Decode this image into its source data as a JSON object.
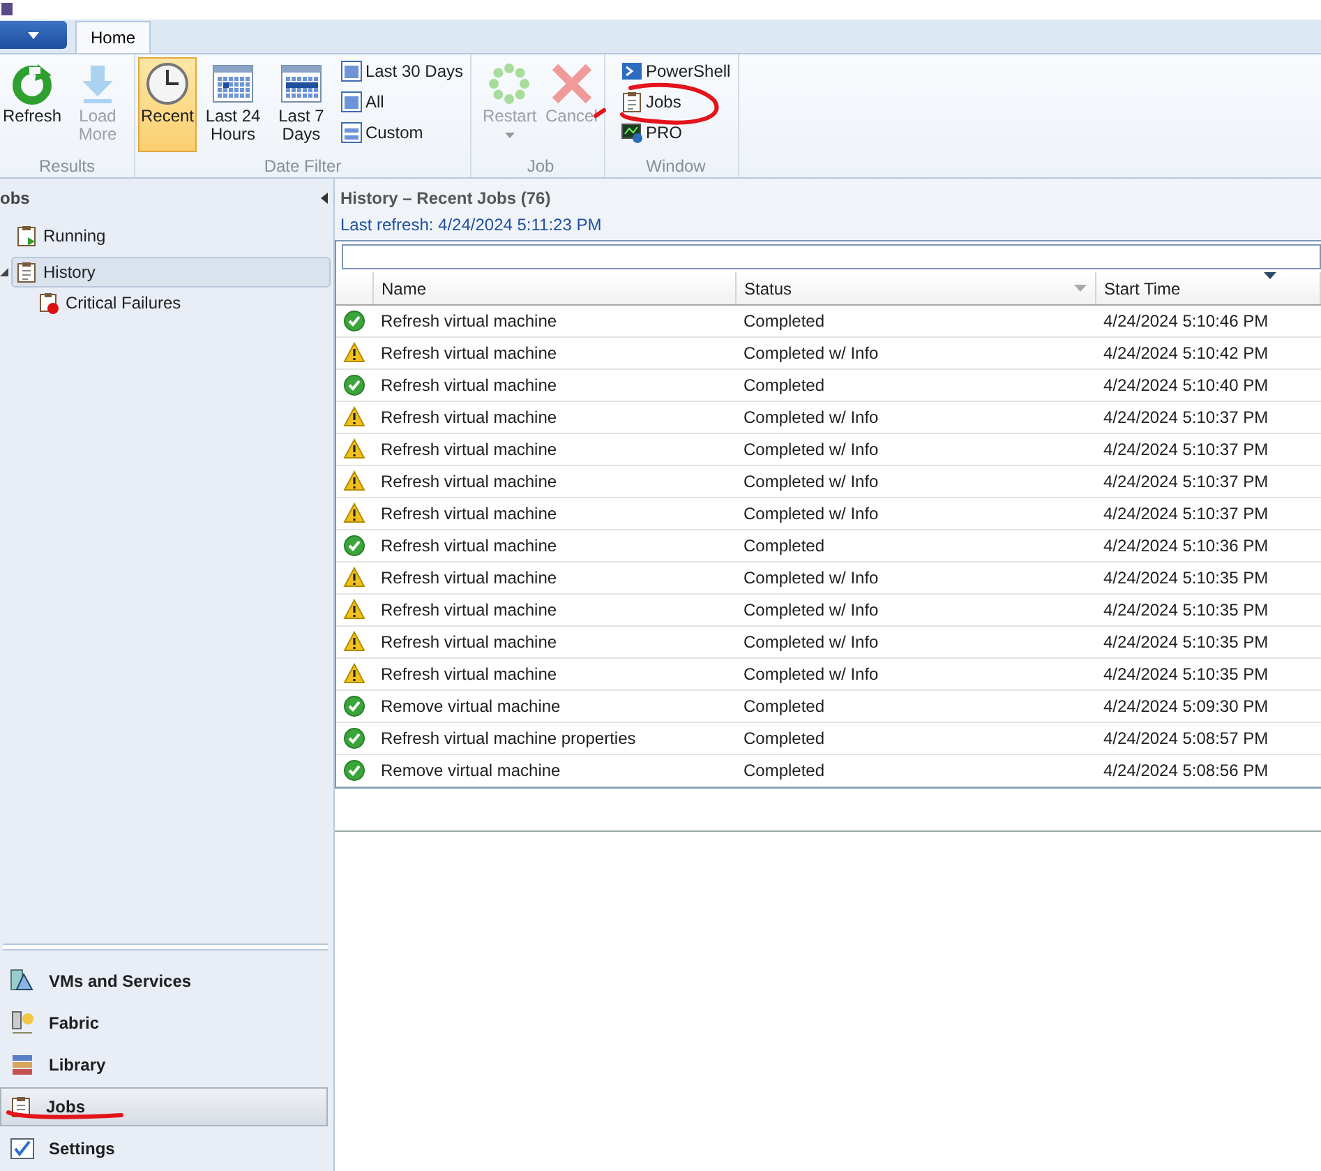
{
  "ribbon": {
    "tabs": [
      {
        "label": "Home",
        "selected": true
      }
    ],
    "groups": [
      {
        "label": "Results",
        "items": [
          {
            "kind": "large",
            "label": "Refresh",
            "selected": false,
            "disabled": false
          },
          {
            "kind": "large",
            "label": "Load More",
            "selected": false,
            "disabled": true
          }
        ]
      },
      {
        "label": "Date Filter",
        "items": [
          {
            "kind": "large",
            "label": "Recent",
            "selected": true,
            "disabled": false
          },
          {
            "kind": "large",
            "label": "Last 24 Hours",
            "selected": false,
            "disabled": false
          },
          {
            "kind": "large",
            "label": "Last 7 Days",
            "selected": false,
            "disabled": false
          },
          {
            "kind": "small",
            "label": "Last 30 Days",
            "selected": false,
            "disabled": false
          },
          {
            "kind": "small",
            "label": "All",
            "selected": false,
            "disabled": false
          },
          {
            "kind": "small",
            "label": "Custom",
            "selected": false,
            "disabled": false
          }
        ]
      },
      {
        "label": "Job",
        "items": [
          {
            "kind": "dropdown",
            "label": "Restart",
            "selected": false,
            "disabled": true
          },
          {
            "kind": "large",
            "label": "Cancel",
            "selected": false,
            "disabled": true
          }
        ]
      },
      {
        "label": "Window",
        "items": [
          {
            "kind": "small",
            "label": "PowerShell",
            "selected": false,
            "disabled": false
          },
          {
            "kind": "small",
            "label": "Jobs",
            "selected": false,
            "disabled": false
          },
          {
            "kind": "small",
            "label": "PRO",
            "selected": false,
            "disabled": false
          }
        ]
      }
    ]
  },
  "sidebar": {
    "title": "obs",
    "tree": [
      {
        "label": "Running",
        "selected": false
      },
      {
        "label": "History",
        "selected": true,
        "expanded": true,
        "children": [
          {
            "label": "Critical Failures",
            "selected": false
          }
        ]
      }
    ],
    "nav": [
      {
        "label": "VMs and Services",
        "selected": false
      },
      {
        "label": "Fabric",
        "selected": false
      },
      {
        "label": "Library",
        "selected": false
      },
      {
        "label": "Jobs",
        "selected": true
      },
      {
        "label": "Settings",
        "selected": false
      }
    ]
  },
  "content": {
    "title": "History – Recent Jobs (76)",
    "last_refresh": "Last refresh: 4/24/2024 5:11:23 PM",
    "table": {
      "columns": [
        {
          "label": "Name",
          "sorted": false,
          "filterable": false
        },
        {
          "label": "Status",
          "sorted": false,
          "filterable": true
        },
        {
          "label": "Start Time",
          "sorted": true,
          "filterable": false
        }
      ],
      "rows": [
        {
          "kind": "ok",
          "name": "Refresh virtual machine",
          "status": "Completed",
          "start_time": "4/24/2024 5:10:46 PM"
        },
        {
          "kind": "info",
          "name": "Refresh virtual machine",
          "status": "Completed w/ Info",
          "start_time": "4/24/2024 5:10:42 PM"
        },
        {
          "kind": "ok",
          "name": "Refresh virtual machine",
          "status": "Completed",
          "start_time": "4/24/2024 5:10:40 PM"
        },
        {
          "kind": "info",
          "name": "Refresh virtual machine",
          "status": "Completed w/ Info",
          "start_time": "4/24/2024 5:10:37 PM"
        },
        {
          "kind": "info",
          "name": "Refresh virtual machine",
          "status": "Completed w/ Info",
          "start_time": "4/24/2024 5:10:37 PM"
        },
        {
          "kind": "info",
          "name": "Refresh virtual machine",
          "status": "Completed w/ Info",
          "start_time": "4/24/2024 5:10:37 PM"
        },
        {
          "kind": "info",
          "name": "Refresh virtual machine",
          "status": "Completed w/ Info",
          "start_time": "4/24/2024 5:10:37 PM"
        },
        {
          "kind": "ok",
          "name": "Refresh virtual machine",
          "status": "Completed",
          "start_time": "4/24/2024 5:10:36 PM"
        },
        {
          "kind": "info",
          "name": "Refresh virtual machine",
          "status": "Completed w/ Info",
          "start_time": "4/24/2024 5:10:35 PM"
        },
        {
          "kind": "info",
          "name": "Refresh virtual machine",
          "status": "Completed w/ Info",
          "start_time": "4/24/2024 5:10:35 PM"
        },
        {
          "kind": "info",
          "name": "Refresh virtual machine",
          "status": "Completed w/ Info",
          "start_time": "4/24/2024 5:10:35 PM"
        },
        {
          "kind": "info",
          "name": "Refresh virtual machine",
          "status": "Completed w/ Info",
          "start_time": "4/24/2024 5:10:35 PM"
        },
        {
          "kind": "ok",
          "name": "Remove virtual machine",
          "status": "Completed",
          "start_time": "4/24/2024 5:09:30 PM"
        },
        {
          "kind": "ok",
          "name": "Refresh virtual machine properties",
          "status": "Completed",
          "start_time": "4/24/2024 5:08:57 PM"
        },
        {
          "kind": "ok",
          "name": "Remove virtual machine",
          "status": "Completed",
          "start_time": "4/24/2024 5:08:56 PM"
        }
      ]
    }
  }
}
